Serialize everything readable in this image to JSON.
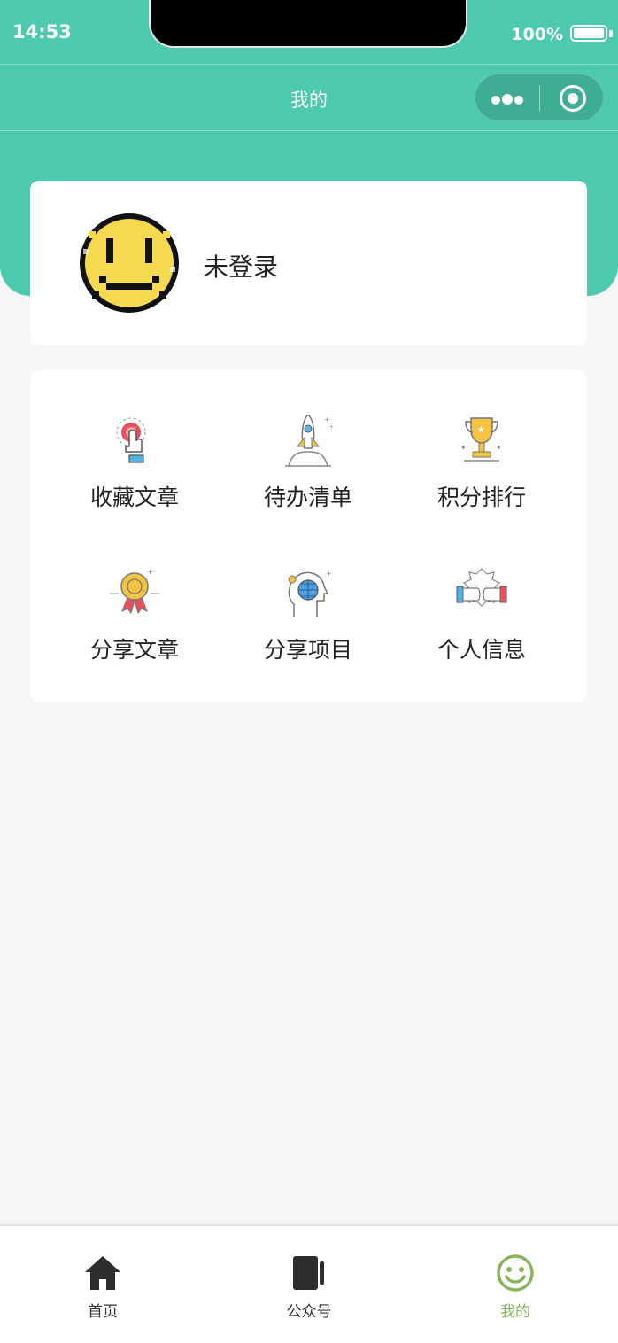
{
  "status_bar": {
    "time": "14:53",
    "battery": "100%"
  },
  "nav": {
    "title": "我的"
  },
  "profile": {
    "name": "未登录"
  },
  "menu": {
    "items": [
      {
        "label": "收藏文章",
        "icon": "tap-button-icon"
      },
      {
        "label": "待办清单",
        "icon": "rocket-icon"
      },
      {
        "label": "积分排行",
        "icon": "trophy-icon"
      },
      {
        "label": "分享文章",
        "icon": "medal-icon"
      },
      {
        "label": "分享项目",
        "icon": "head-globe-icon"
      },
      {
        "label": "个人信息",
        "icon": "fist-bump-icon"
      }
    ]
  },
  "tabs": [
    {
      "label": "首页",
      "icon": "home-icon"
    },
    {
      "label": "公众号",
      "icon": "notebook-icon"
    },
    {
      "label": "我的",
      "icon": "smile-icon",
      "active": true
    }
  ],
  "colors": {
    "theme": "#4cc9ae",
    "tab_active": "#8bb55c",
    "background": "#f6f6f6"
  }
}
